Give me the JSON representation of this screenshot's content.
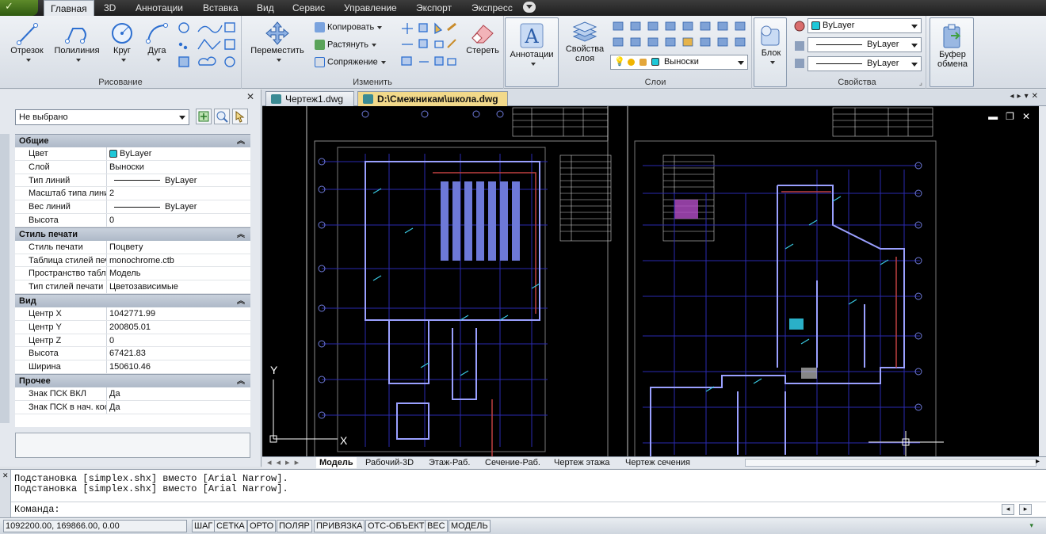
{
  "menu": {
    "logo_text": "✓",
    "tabs": [
      "Главная",
      "3D",
      "Аннотации",
      "Вставка",
      "Вид",
      "Сервис",
      "Управление",
      "Экспорт",
      "Экспресс"
    ]
  },
  "ribbon": {
    "draw": {
      "label": "Рисование",
      "line": "Отрезок",
      "polyline": "Полилиния",
      "circle": "Круг",
      "arc": "Дуга"
    },
    "modify": {
      "label": "Изменить",
      "move": "Переместить",
      "copy": "Копировать",
      "stretch": "Растянуть",
      "fillet": "Сопряжение",
      "erase": "Стереть"
    },
    "annot": {
      "label": "Аннотации"
    },
    "layers": {
      "label": "Слои",
      "props": "Свойства слоя",
      "current_layer": "Выноски"
    },
    "block": {
      "label": "Блок"
    },
    "properties": {
      "label": "Свойства",
      "color": "ByLayer",
      "linetype": "ByLayer",
      "lineweight": "ByLayer"
    },
    "clipboard": {
      "label": "Буфер обмена"
    }
  },
  "props_panel": {
    "selection": "Не выбрано",
    "sections": [
      {
        "title": "Общие",
        "rows": [
          [
            "Цвет",
            "ByLayer"
          ],
          [
            "Слой",
            "Выноски"
          ],
          [
            "Тип линий",
            "ByLayer"
          ],
          [
            "Масштаб типа линии",
            "2"
          ],
          [
            "Вес линий",
            "ByLayer"
          ],
          [
            "Высота",
            "0"
          ]
        ]
      },
      {
        "title": "Стиль печати",
        "rows": [
          [
            "Стиль печати",
            "Поцвету"
          ],
          [
            "Таблица стилей печ...",
            "monochrome.ctb"
          ],
          [
            "Пространство табли...",
            "Модель"
          ],
          [
            "Тип стилей печати",
            "Цветозависимые"
          ]
        ]
      },
      {
        "title": "Вид",
        "rows": [
          [
            "Центр X",
            "1042771.99"
          ],
          [
            "Центр Y",
            "200805.01"
          ],
          [
            "Центр Z",
            "0"
          ],
          [
            "Высота",
            "67421.83"
          ],
          [
            "Ширина",
            "150610.46"
          ]
        ]
      },
      {
        "title": "Прочее",
        "rows": [
          [
            "Знак ПСК ВКЛ",
            "Да"
          ],
          [
            "Знак ПСК в нач. коо...",
            "Да"
          ]
        ]
      }
    ]
  },
  "doc_tabs": [
    "Чертеж1.dwg",
    "D:\\Смежникам\\школа.dwg"
  ],
  "canvas": {
    "axis_y": "Y",
    "axis_x": "X"
  },
  "layout_tabs": [
    "Модель",
    "Рабочий-3D",
    "Этаж-Раб.",
    "Сечение-Раб.",
    "Чертеж этажа",
    "Чертеж сечения"
  ],
  "command": {
    "history": [
      "Подстановка [simplex.shx] вместо [Arial Narrow].",
      "Подстановка [simplex.shx] вместо [Arial Narrow]."
    ],
    "prompt": "Команда:"
  },
  "status": {
    "coords": "1092200.00, 169866.00, 0.00",
    "toggles": [
      "ШАГ",
      "СЕТКА",
      "ОРТО",
      "ПОЛЯР",
      "ПРИВЯЗКА",
      "ОТС-ОБЪЕКТ",
      "ВЕС",
      "МОДЕЛЬ"
    ]
  },
  "colors": {
    "swatch": "#1ec8d8",
    "canvas": "#000000",
    "accent": "#f2d98a"
  }
}
